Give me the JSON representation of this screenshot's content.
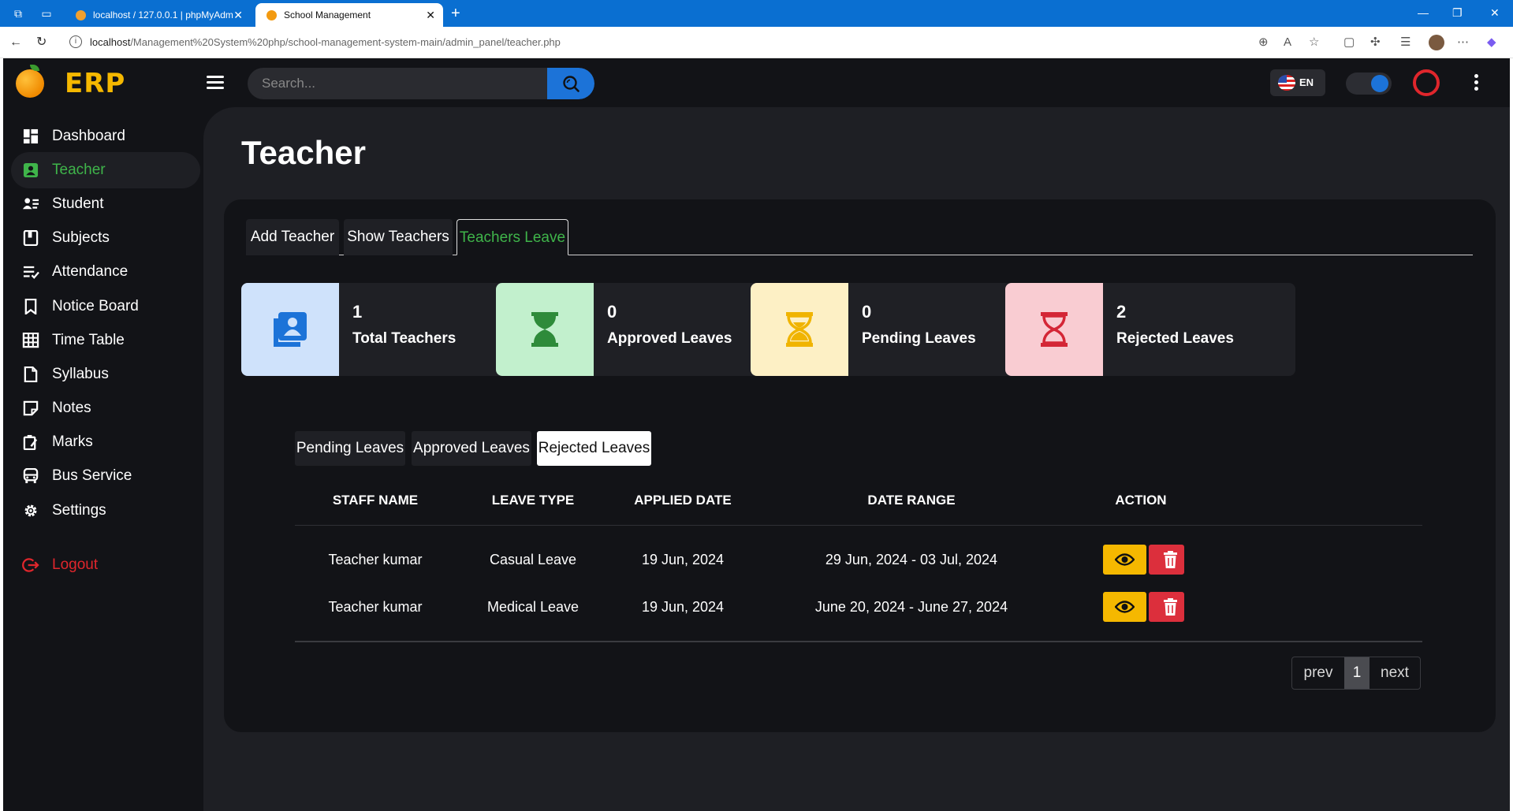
{
  "browser": {
    "tabs": [
      {
        "title": "localhost / 127.0.0.1 | phpMyAdm"
      },
      {
        "title": "School Management"
      }
    ],
    "url_host": "localhost",
    "url_path": "/Management%20System%20php/school-management-system-main/admin_panel/teacher.php"
  },
  "header": {
    "logo_text": "ERP",
    "search_placeholder": "Search...",
    "language": "EN"
  },
  "sidebar": {
    "items": [
      {
        "label": "Dashboard",
        "icon": "dashboard-icon"
      },
      {
        "label": "Teacher",
        "icon": "teacher-icon",
        "active": true
      },
      {
        "label": "Student",
        "icon": "student-icon"
      },
      {
        "label": "Subjects",
        "icon": "book-icon"
      },
      {
        "label": "Attendance",
        "icon": "attendance-icon"
      },
      {
        "label": "Notice Board",
        "icon": "bookmark-icon"
      },
      {
        "label": "Time Table",
        "icon": "grid-icon"
      },
      {
        "label": "Syllabus",
        "icon": "file-icon"
      },
      {
        "label": "Notes",
        "icon": "notes-icon"
      },
      {
        "label": "Marks",
        "icon": "marks-icon"
      },
      {
        "label": "Bus Service",
        "icon": "bus-icon"
      },
      {
        "label": "Settings",
        "icon": "gear-icon"
      }
    ],
    "logout": "Logout"
  },
  "page": {
    "title": "Teacher",
    "tabs": [
      "Add Teacher",
      "Show Teachers",
      "Teachers Leave"
    ],
    "active_tab": "Teachers Leave"
  },
  "stats": [
    {
      "value": "1",
      "label": "Total Teachers",
      "color": "#1c73d8",
      "bg": "#cfe2fb"
    },
    {
      "value": "0",
      "label": "Approved Leaves",
      "color": "#2e8b3a",
      "bg": "#c2f0cd"
    },
    {
      "value": "0",
      "label": "Pending Leaves",
      "color": "#f0b400",
      "bg": "#fdf0c5"
    },
    {
      "value": "2",
      "label": "Rejected Leaves",
      "color": "#d42636",
      "bg": "#f9ccd2"
    }
  ],
  "leave_tabs": [
    "Pending Leaves",
    "Approved Leaves",
    "Rejected Leaves"
  ],
  "active_leave_tab": "Rejected Leaves",
  "table": {
    "headers": [
      "STAFF NAME",
      "LEAVE TYPE",
      "APPLIED DATE",
      "DATE RANGE",
      "ACTION"
    ],
    "rows": [
      [
        "Teacher kumar",
        "Casual Leave",
        "19 Jun, 2024",
        "29 Jun, 2024 - 03 Jul, 2024"
      ],
      [
        "Teacher kumar",
        "Medical Leave",
        "19 Jun, 2024",
        "June 20, 2024 - June 27, 2024"
      ]
    ]
  },
  "pagination": {
    "prev": "prev",
    "current": "1",
    "next": "next"
  }
}
